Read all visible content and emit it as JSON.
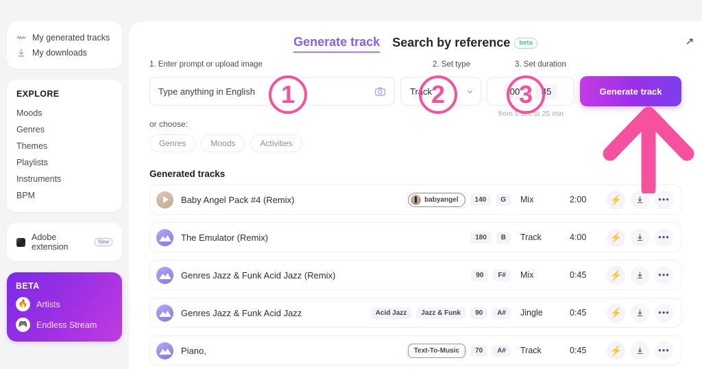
{
  "sidebar": {
    "quick_links": [
      {
        "label": "My generated tracks",
        "icon": "waveform-icon"
      },
      {
        "label": "My downloads",
        "icon": "download-icon"
      }
    ],
    "explore": {
      "title": "EXPLORE",
      "items": [
        "Moods",
        "Genres",
        "Themes",
        "Playlists",
        "Instruments",
        "BPM"
      ]
    },
    "extension": {
      "label": "Adobe extension",
      "badge": "New"
    },
    "beta": {
      "title": "BETA",
      "items": [
        {
          "label": "Artists",
          "icon": "flame-icon",
          "glyph": "🔥"
        },
        {
          "label": "Endless Stream",
          "icon": "gamepad-icon",
          "glyph": "🎮"
        }
      ]
    }
  },
  "header": {
    "tabs": [
      {
        "label": "Generate track",
        "active": true,
        "badge": ""
      },
      {
        "label": "Search by reference",
        "active": false,
        "badge": "beta"
      }
    ],
    "collapse_icon": "chevron-up-right-icon"
  },
  "form": {
    "steps": [
      "1. Enter prompt or upload image",
      "2. Set type",
      "3. Set duration"
    ],
    "prompt_placeholder": "Type anything in English",
    "prompt_value": "",
    "upload_icon": "camera-icon",
    "type_value": "Track",
    "duration": {
      "minutes": "00",
      "separator": ":",
      "seconds": "45"
    },
    "generate_label": "Generate track",
    "duration_hint": "from 5 sec to 25 min",
    "or_choose": "or choose:",
    "chips": [
      "Genres",
      "Moods",
      "Activities"
    ]
  },
  "tracks": {
    "section_title": "Generated tracks",
    "rows": [
      {
        "thumb": "tan-play",
        "name": "Baby Angel Pack #4 (Remix)",
        "tags": [
          {
            "text": "babyangel",
            "style": "avatar-purple-outline"
          },
          {
            "text": "140",
            "style": "plain"
          },
          {
            "text": "G",
            "style": "plain"
          }
        ],
        "type": "Mix",
        "duration": "2:00"
      },
      {
        "thumb": "gradient-mountain",
        "name": "The Emulator (Remix)",
        "tags": [
          {
            "text": "180",
            "style": "plain"
          },
          {
            "text": "B",
            "style": "plain"
          }
        ],
        "type": "Track",
        "duration": "4:00"
      },
      {
        "thumb": "gradient-mountain",
        "name": "Genres Jazz & Funk Acid Jazz (Remix)",
        "tags": [
          {
            "text": "90",
            "style": "plain"
          },
          {
            "text": "F#",
            "style": "plain"
          }
        ],
        "type": "Mix",
        "duration": "0:45"
      },
      {
        "thumb": "gradient-mountain",
        "name": "Genres Jazz & Funk Acid Jazz",
        "tags": [
          {
            "text": "Acid Jazz",
            "style": "plain"
          },
          {
            "text": "Jazz & Funk",
            "style": "plain"
          },
          {
            "text": "90",
            "style": "plain"
          },
          {
            "text": "A#",
            "style": "plain"
          }
        ],
        "type": "Jingle",
        "duration": "0:45"
      },
      {
        "thumb": "gradient-mountain",
        "name": "Piano,",
        "tags": [
          {
            "text": "Text-To-Music",
            "style": "pink-outline"
          },
          {
            "text": "70",
            "style": "plain"
          },
          {
            "text": "A#",
            "style": "plain"
          }
        ],
        "type": "Track",
        "duration": "0:45"
      }
    ],
    "actions": {
      "boost_icon": "lightning-bolt-icon",
      "download_icon": "download-icon",
      "more_icon": "ellipsis-icon"
    }
  },
  "annotations": {
    "markers": [
      "1",
      "2",
      "3"
    ],
    "arrow_icon": "up-arrow-annotation",
    "color": "#f5519e"
  },
  "colors": {
    "accent_purple": "#8b5cf6",
    "brand_gradient_start": "#c43ce4",
    "brand_gradient_end": "#7b3ff0",
    "annotation_pink": "#f5519e",
    "page_background": "#f4f4f6"
  }
}
